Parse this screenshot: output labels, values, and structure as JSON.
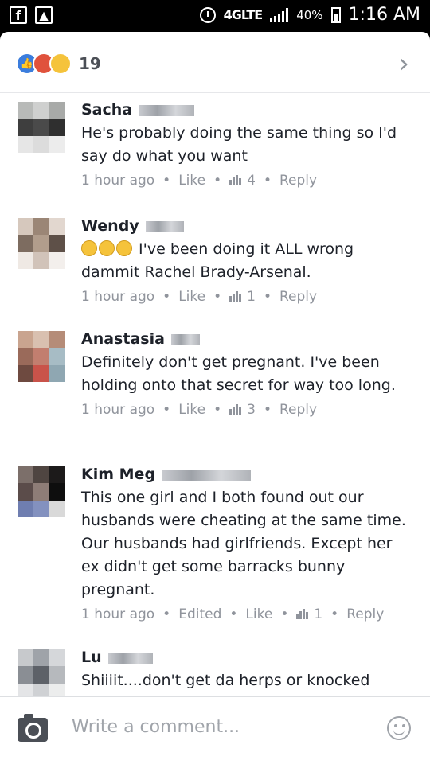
{
  "status_bar": {
    "network": "4GLTE",
    "battery": "40%",
    "time": "1:16 AM"
  },
  "header": {
    "reactions": [
      "like",
      "angry",
      "haha"
    ],
    "reaction_count": "19"
  },
  "comments": [
    {
      "name": "Sacha",
      "text": "He's probably doing the same thing so I'd say do what you want",
      "time": "1 hour ago",
      "edited": "",
      "like_label": "Like",
      "likes": "4",
      "reply_label": "Reply"
    },
    {
      "name": "Wendy",
      "text": "I've been doing it ALL wrong dammit Rachel Brady-Arsenal.",
      "time": "1 hour ago",
      "edited": "",
      "like_label": "Like",
      "likes": "1",
      "reply_label": "Reply"
    },
    {
      "name": "Anastasia",
      "text": "Definitely don't get pregnant. I've been holding onto that secret for way too long.",
      "time": "1 hour ago",
      "edited": "",
      "like_label": "Like",
      "likes": "3",
      "reply_label": "Reply"
    },
    {
      "name": "Kim Meg",
      "text": "This one girl and I both found out our husbands were cheating at the same time. Our husbands had girlfriends. Except her ex didn't get some barracks bunny pregnant.",
      "time": "1 hour ago",
      "edited": "Edited",
      "like_label": "Like",
      "likes": "1",
      "reply_label": "Reply"
    },
    {
      "name": "Lu",
      "text": "Shiiiit....don't get da herps or knocked",
      "time": "",
      "edited": "",
      "like_label": "",
      "likes": "",
      "reply_label": ""
    }
  ],
  "composer": {
    "placeholder": "Write a comment..."
  },
  "colors": {
    "like_blue": "#3b7ddd",
    "angry_red": "#e0523c",
    "haha_yellow": "#f5c33b",
    "meta_gray": "#90949c"
  }
}
